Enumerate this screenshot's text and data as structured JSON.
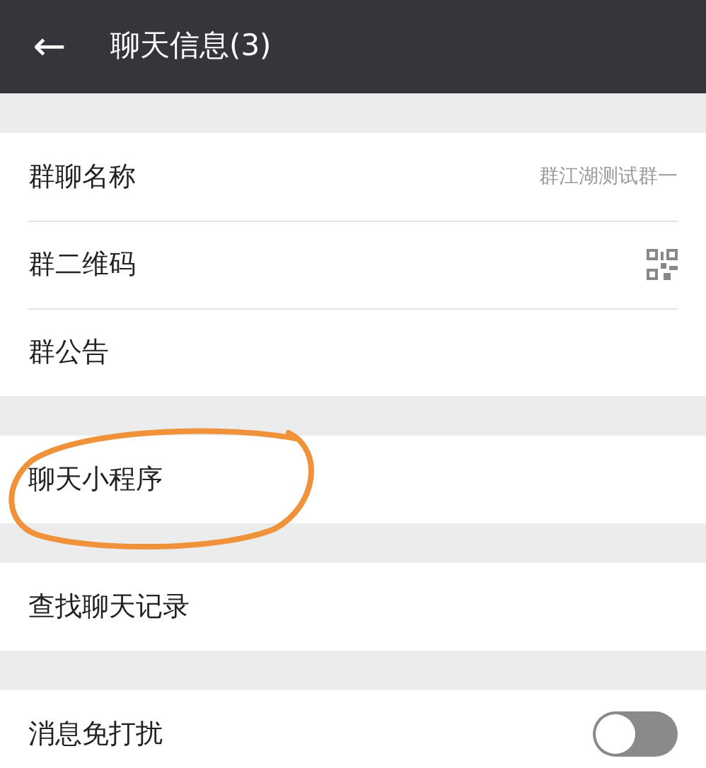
{
  "header": {
    "back_icon": "←",
    "title": "聊天信息(3)"
  },
  "sections": [
    {
      "items": [
        {
          "kind": "value",
          "label": "群聊名称",
          "value": "群江湖测试群一"
        },
        {
          "kind": "qr",
          "label": "群二维码"
        },
        {
          "kind": "plain",
          "label": "群公告"
        }
      ]
    },
    {
      "items": [
        {
          "kind": "plain",
          "label": "聊天小程序",
          "circled": true
        }
      ]
    },
    {
      "items": [
        {
          "kind": "plain",
          "label": "查找聊天记录"
        }
      ]
    },
    {
      "items": [
        {
          "kind": "toggle",
          "label": "消息免打扰",
          "on": false
        }
      ]
    }
  ]
}
